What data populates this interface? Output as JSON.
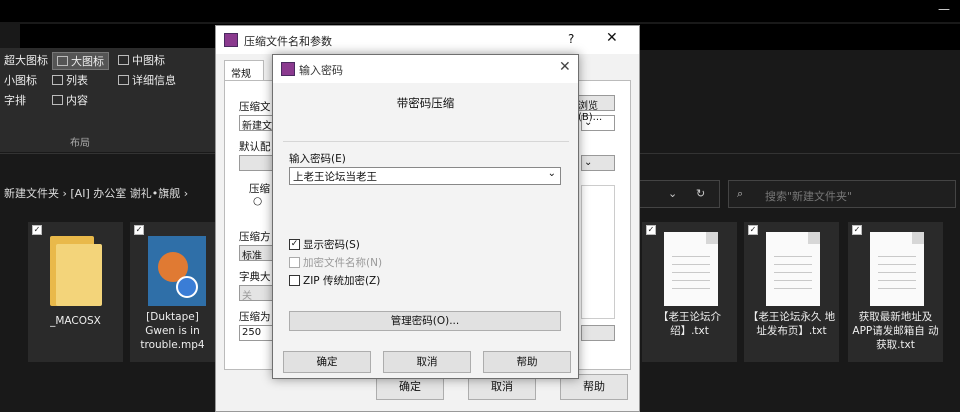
{
  "explorer": {
    "ribbon": {
      "items": [
        "超大图标",
        "大图标",
        "中图标",
        "小图标",
        "列表",
        "详细信息",
        "字排",
        "内容"
      ],
      "group_label": "布局"
    },
    "breadcrumb": "新建文件夹 › [AI] 办公室 谢礼•旗舰 ›",
    "search_placeholder": "搜索\"新建文件夹\"",
    "minimize": "—",
    "files": [
      {
        "name": "_MACOSX",
        "type": "folder"
      },
      {
        "name": "[Duktape] Gwen is in trouble.mp4",
        "type": "video"
      },
      {
        "name": "【老王论坛介 绍】.txt",
        "type": "text"
      },
      {
        "name": "【老王论坛永久 地址发布页】.txt",
        "type": "text"
      },
      {
        "name": "获取最新地址及 APP请发邮箱自 动获取.txt",
        "type": "text"
      }
    ]
  },
  "archive_dialog": {
    "title": "压缩文件名和参数",
    "help": "?",
    "close": "✕",
    "tab_general": "常规",
    "labels": {
      "archive_name": "压缩文",
      "default_profile": "默认配",
      "format": "压缩",
      "method": "压缩方",
      "dict": "字典大",
      "split": "压缩为"
    },
    "values": {
      "archive_name": "新建文",
      "method": "标准",
      "dict": "关",
      "split": "250"
    },
    "browse_button": "浏览(B)...",
    "ok": "确定",
    "cancel": "取消",
    "help_button": "帮助"
  },
  "password_dialog": {
    "title": "输入密码",
    "close": "✕",
    "heading": "带密码压缩",
    "input_label": "输入密码(E)",
    "password_value": "上老王论坛当老王",
    "show_password": "显示密码(S)",
    "encrypt_names": "加密文件名称(N)",
    "zip_legacy": "ZIP 传统加密(Z)",
    "manage_button": "管理密码(O)...",
    "ok": "确定",
    "cancel": "取消",
    "help": "帮助"
  }
}
